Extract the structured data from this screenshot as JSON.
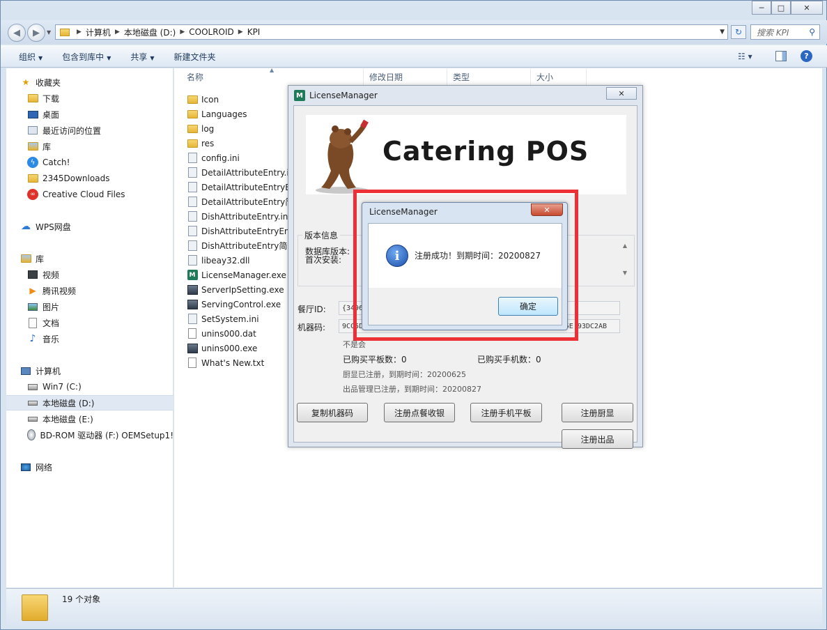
{
  "explorer": {
    "address": [
      "计算机",
      "本地磁盘 (D:)",
      "COOLROID",
      "KPI"
    ],
    "search_placeholder": "搜索 KPI",
    "toolbar": [
      "组织",
      "包含到库中",
      "共享",
      "新建文件夹"
    ],
    "columns": [
      "名称",
      "修改日期",
      "类型",
      "大小"
    ],
    "nav": {
      "favorites": "收藏夹",
      "favorites_items": [
        "下载",
        "桌面",
        "最近访问的位置",
        "库",
        "Catch!",
        "2345Downloads",
        "Creative Cloud Files"
      ],
      "wps": "WPS网盘",
      "library": "库",
      "library_items": [
        "视频",
        "腾讯视频",
        "图片",
        "文档",
        "音乐"
      ],
      "computer": "计算机",
      "computer_items": [
        "Win7 (C:)",
        "本地磁盘 (D:)",
        "本地磁盘 (E:)",
        "BD-ROM 驱动器 (F:) OEMSetup1!"
      ],
      "network": "网络"
    },
    "files": [
      {
        "name": "Icon",
        "kind": "folder"
      },
      {
        "name": "Languages",
        "kind": "folder"
      },
      {
        "name": "log",
        "kind": "folder"
      },
      {
        "name": "res",
        "kind": "folder"
      },
      {
        "name": "config.ini",
        "kind": "ini"
      },
      {
        "name": "DetailAttributeEntry.ini",
        "kind": "ini"
      },
      {
        "name": "DetailAttributeEntryEn",
        "kind": "ini"
      },
      {
        "name": "DetailAttributeEntry简",
        "kind": "ini"
      },
      {
        "name": "DishAttributeEntry.ini",
        "kind": "ini"
      },
      {
        "name": "DishAttributeEntryEng",
        "kind": "ini"
      },
      {
        "name": "DishAttributeEntry简体",
        "kind": "ini"
      },
      {
        "name": "libeay32.dll",
        "kind": "dll"
      },
      {
        "name": "LicenseManager.exe",
        "kind": "lm"
      },
      {
        "name": "ServerIpSetting.exe",
        "kind": "exe"
      },
      {
        "name": "ServingControl.exe",
        "kind": "exe"
      },
      {
        "name": "SetSystem.ini",
        "kind": "ini"
      },
      {
        "name": "unins000.dat",
        "kind": "dat"
      },
      {
        "name": "unins000.exe",
        "kind": "exe"
      },
      {
        "name": "What's New.txt",
        "kind": "txt"
      }
    ],
    "status": "19 个对象"
  },
  "license_manager": {
    "title": "LicenseManager",
    "banner_text": "Catering POS",
    "version_group": "版本信息",
    "db_version_label": "数据库版本:",
    "first_install_label": "首次安装:",
    "restaurant_id_label": "餐厅ID:",
    "restaurant_id_value": "{3496",
    "machine_code_label": "机器码:",
    "machine_code_value": "9CC5DA",
    "machine_code_tail": "5E 93DC2AB",
    "line_unregistered": "不是会",
    "line_pos_count": "已购买平板数：0",
    "line_mobile_count": "已购买手机数：0",
    "kds_status": "厨显已注册，到期时间：20200625",
    "dish_status": "出品管理已注册，到期时间：20200827",
    "buttons": [
      "复制机器码",
      "注册点餐收银",
      "注册手机平板",
      "注册厨显",
      "注册出品"
    ]
  },
  "dialog": {
    "title": "LicenseManager",
    "message": "注册成功！到期时间：20200827",
    "ok": "确定"
  },
  "colors": {
    "highlight": "#ec3035",
    "accent": "#1c4fa8"
  }
}
